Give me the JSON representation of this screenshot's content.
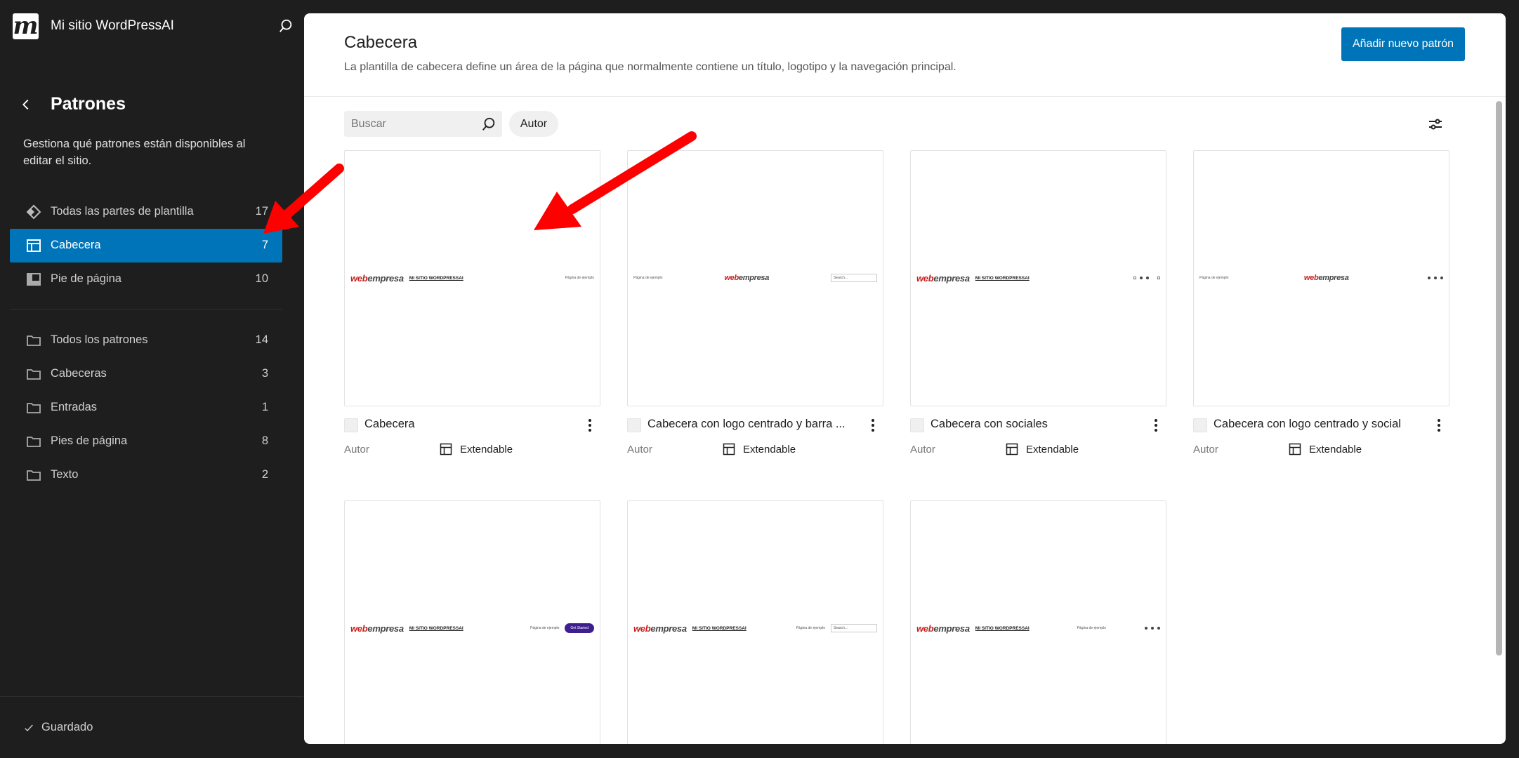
{
  "site": {
    "logo_letter": "m",
    "name": "Mi sitio WordPressAI"
  },
  "sidebar": {
    "title": "Patrones",
    "description": "Gestiona qué patrones están disponibles al editar el sitio.",
    "parts": [
      {
        "label": "Todas las partes de plantilla",
        "count": "17",
        "icon": "diamond-icon"
      },
      {
        "label": "Cabecera",
        "count": "7",
        "icon": "header-layout-icon",
        "active": true
      },
      {
        "label": "Pie de página",
        "count": "10",
        "icon": "footer-layout-icon"
      }
    ],
    "categories": [
      {
        "label": "Todos los patrones",
        "count": "14"
      },
      {
        "label": "Cabeceras",
        "count": "3"
      },
      {
        "label": "Entradas",
        "count": "1"
      },
      {
        "label": "Pies de página",
        "count": "8"
      },
      {
        "label": "Texto",
        "count": "2"
      }
    ],
    "status": "Guardado"
  },
  "main": {
    "title": "Cabecera",
    "description": "La plantilla de cabecera define un área de la página que normalmente contiene un título, logotipo y la navegación principal.",
    "add_button": "Añadir nuevo patrón",
    "search_placeholder": "Buscar",
    "author_filter": "Autor"
  },
  "preview": {
    "logo_a": "web",
    "logo_b": "empresa",
    "site": "MI SITIO WORDPRESSAI",
    "page_link": "Página de ejemplo",
    "search_ph": "Search...",
    "cta": "Get Started"
  },
  "cards": [
    {
      "title": "Cabecera",
      "author": "Autor",
      "type": "Extendable"
    },
    {
      "title": "Cabecera con logo centrado y barra ...",
      "author": "Autor",
      "type": "Extendable"
    },
    {
      "title": "Cabecera con sociales",
      "author": "Autor",
      "type": "Extendable"
    },
    {
      "title": "Cabecera con logo centrado y social",
      "author": "Autor",
      "type": "Extendable"
    }
  ],
  "colors": {
    "accent": "#0074b8",
    "sidebar_bg": "#1e1e1e",
    "annotation_arrow": "#ff0000"
  }
}
